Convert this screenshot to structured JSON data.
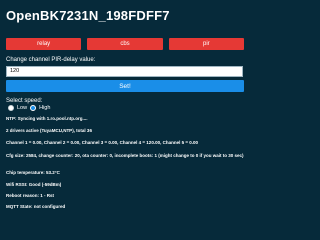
{
  "page": {
    "title": "OpenBK7231N_198FDFF7"
  },
  "toggles": [
    {
      "label": "relay"
    },
    {
      "label": "cbs"
    },
    {
      "label": "pir"
    }
  ],
  "pir_form": {
    "label": "Change channel PIR-delay value:",
    "value": "120",
    "button": "Set!"
  },
  "speed": {
    "label": "Select speed:",
    "options": [
      "Low",
      "High"
    ],
    "selected": "High"
  },
  "status": {
    "ntp": "NTP: Syncing with 1.ro.pool.ntp.org....",
    "drivers": "2 drivers active (TuyaMCU,NTP), total 36",
    "channels": "Channel 1 = 0.00, Channel 2 = 0.00, Channel 3 = 0.00, Channel 4 = 120.00, Channel 5 = 0.00",
    "cfg": "Cfg size: 2584, change counter: 20, ota counter: 0, incomplete boots: 1 (might change to 0 if you wait to 30 sec)",
    "chip_temp": "Chip temperature: 53.2°C",
    "wifi": "Wifi RSSI: Good (-59dBm)",
    "reboot": "Reboot reason: 1 - Rst",
    "mqtt": "MQTT State: not configured"
  },
  "colors": {
    "background": "#062a3a",
    "toggle_red": "#e53935",
    "button_blue": "#1a8ee8"
  }
}
